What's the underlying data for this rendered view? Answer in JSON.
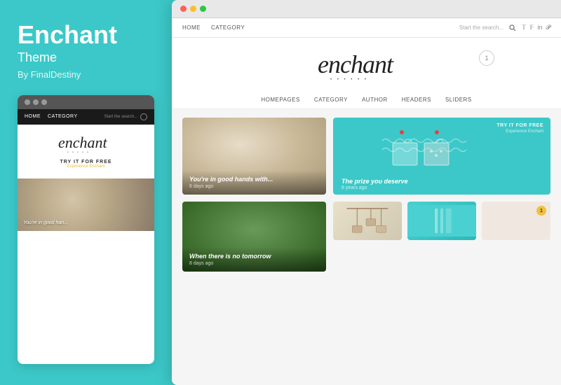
{
  "sidebar": {
    "title": "Enchant",
    "subtitle": "Theme",
    "author": "By FinalDestiny",
    "dots": [
      "dot1",
      "dot2",
      "dot3"
    ]
  },
  "mini_preview": {
    "nav_links": [
      "HOME",
      "CATEGORY"
    ],
    "search_placeholder": "Start the search...",
    "logo_text": "enchant",
    "cta_main": "TRY IT FOR FREE",
    "cta_sub": "Experience Enchant",
    "bottom_image_text": "You're in good han..."
  },
  "browser": {
    "dots": [
      "red",
      "yellow",
      "green"
    ]
  },
  "theme_nav": {
    "links": [
      "HOME",
      "CATEGORY"
    ],
    "search_placeholder": "Start the search...",
    "social_icons": [
      "t",
      "f",
      "in",
      "p"
    ]
  },
  "theme_logo": {
    "text": "enchant",
    "dots": "• • • • • •",
    "badge": "1"
  },
  "secondary_nav": {
    "items": [
      "HOMEPAGES",
      "CATEGORY",
      "AUTHOR",
      "HEADERS",
      "SLIDERS"
    ]
  },
  "cards": {
    "card1": {
      "title": "You're in good hands with...",
      "meta": "6 days ago"
    },
    "card2": {
      "cta": "TRY IT FOR FREE",
      "cta_sub": "Experience Enchant",
      "prize_title": "The prize you deserve",
      "prize_meta": "8 years ago"
    },
    "card3": {
      "title": "When there is no tomorrow",
      "meta": "8 days ago"
    },
    "bottom_badge": "1"
  },
  "colors": {
    "teal": "#3cc8c8",
    "dark": "#1a1a1a",
    "accent_yellow": "#f0c040"
  }
}
